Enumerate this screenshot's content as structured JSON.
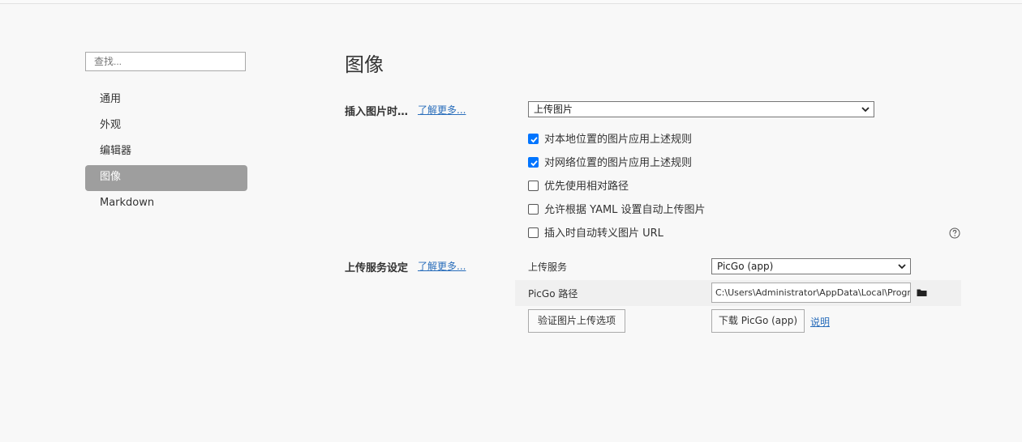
{
  "sidebar": {
    "search_placeholder": "查找...",
    "items": [
      {
        "label": "通用"
      },
      {
        "label": "外观"
      },
      {
        "label": "编辑器"
      },
      {
        "label": "图像"
      },
      {
        "label": "Markdown"
      }
    ],
    "active_index": 3
  },
  "main": {
    "title": "图像",
    "insert_section": {
      "label": "插入图片时…",
      "learn_more": "了解更多...",
      "select_value": "上传图片",
      "options": [
        {
          "label": "对本地位置的图片应用上述规则",
          "checked": true
        },
        {
          "label": "对网络位置的图片应用上述规则",
          "checked": true
        },
        {
          "label": "优先使用相对路径",
          "checked": false
        },
        {
          "label": "允许根据 YAML 设置自动上传图片",
          "checked": false
        },
        {
          "label": "插入时自动转义图片 URL",
          "checked": false
        }
      ]
    },
    "upload_section": {
      "label": "上传服务设定",
      "learn_more": "了解更多...",
      "service_label": "上传服务",
      "service_value": "PicGo (app)",
      "path_label": "PicGo 路径",
      "path_value": "C:\\Users\\Administrator\\AppData\\Local\\Programs\\PicGo\\PicGo.exe",
      "verify_button": "验证图片上传选项",
      "download_button": "下载 PicGo (app)",
      "doc_link": "说明"
    }
  },
  "colors": {
    "accent": "#0075ff",
    "link": "#2a6ebb",
    "active_nav": "#9e9e9e"
  }
}
